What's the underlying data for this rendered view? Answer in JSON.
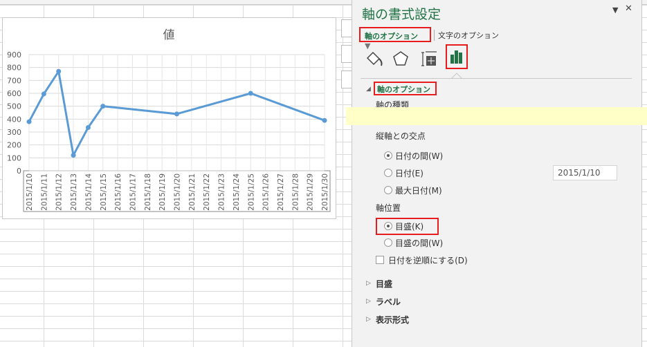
{
  "chart_data": {
    "type": "line",
    "title": "値",
    "categories": [
      "2015/1/10",
      "2015/1/11",
      "2015/1/12",
      "2015/1/13",
      "2015/1/14",
      "2015/1/15",
      "2015/1/16",
      "2015/1/17",
      "2015/1/18",
      "2015/1/19",
      "2015/1/20",
      "2015/1/21",
      "2015/1/22",
      "2015/1/23",
      "2015/1/24",
      "2015/1/25",
      "2015/1/26",
      "2015/1/27",
      "2015/1/28",
      "2015/1/29",
      "2015/1/30"
    ],
    "series": [
      {
        "name": "値",
        "points": [
          [
            "2015/1/10",
            380
          ],
          [
            "2015/1/11",
            595
          ],
          [
            "2015/1/12",
            770
          ],
          [
            "2015/1/13",
            120
          ],
          [
            "2015/1/14",
            335
          ],
          [
            "2015/1/15",
            500
          ],
          [
            "2015/1/20",
            440
          ],
          [
            "2015/1/25",
            600
          ],
          [
            "2015/1/30",
            390
          ]
        ]
      }
    ],
    "ylim": [
      0,
      900
    ],
    "yticks": [
      0,
      100,
      200,
      300,
      400,
      500,
      600,
      700,
      800,
      900
    ],
    "grid": true,
    "line_color": "#5b9bd5"
  },
  "panel": {
    "title": "軸の書式設定",
    "tab_axis_options": "軸のオプション",
    "tab_text_options": "文字のオプション",
    "section_axis_options": "軸のオプション",
    "axis_type_label": "軸の種類",
    "cross_label": "縦軸との交点",
    "cross_options": [
      "日付の間(W)",
      "日付(E)",
      "最大日付(M)"
    ],
    "cross_date_value": "2015/1/10",
    "position_label": "軸位置",
    "position_options": [
      "目盛(K)",
      "目盛の間(W)"
    ],
    "reverse_label": "日付を逆順にする(D)",
    "sections": [
      "目盛",
      "ラベル",
      "表示形式"
    ]
  }
}
